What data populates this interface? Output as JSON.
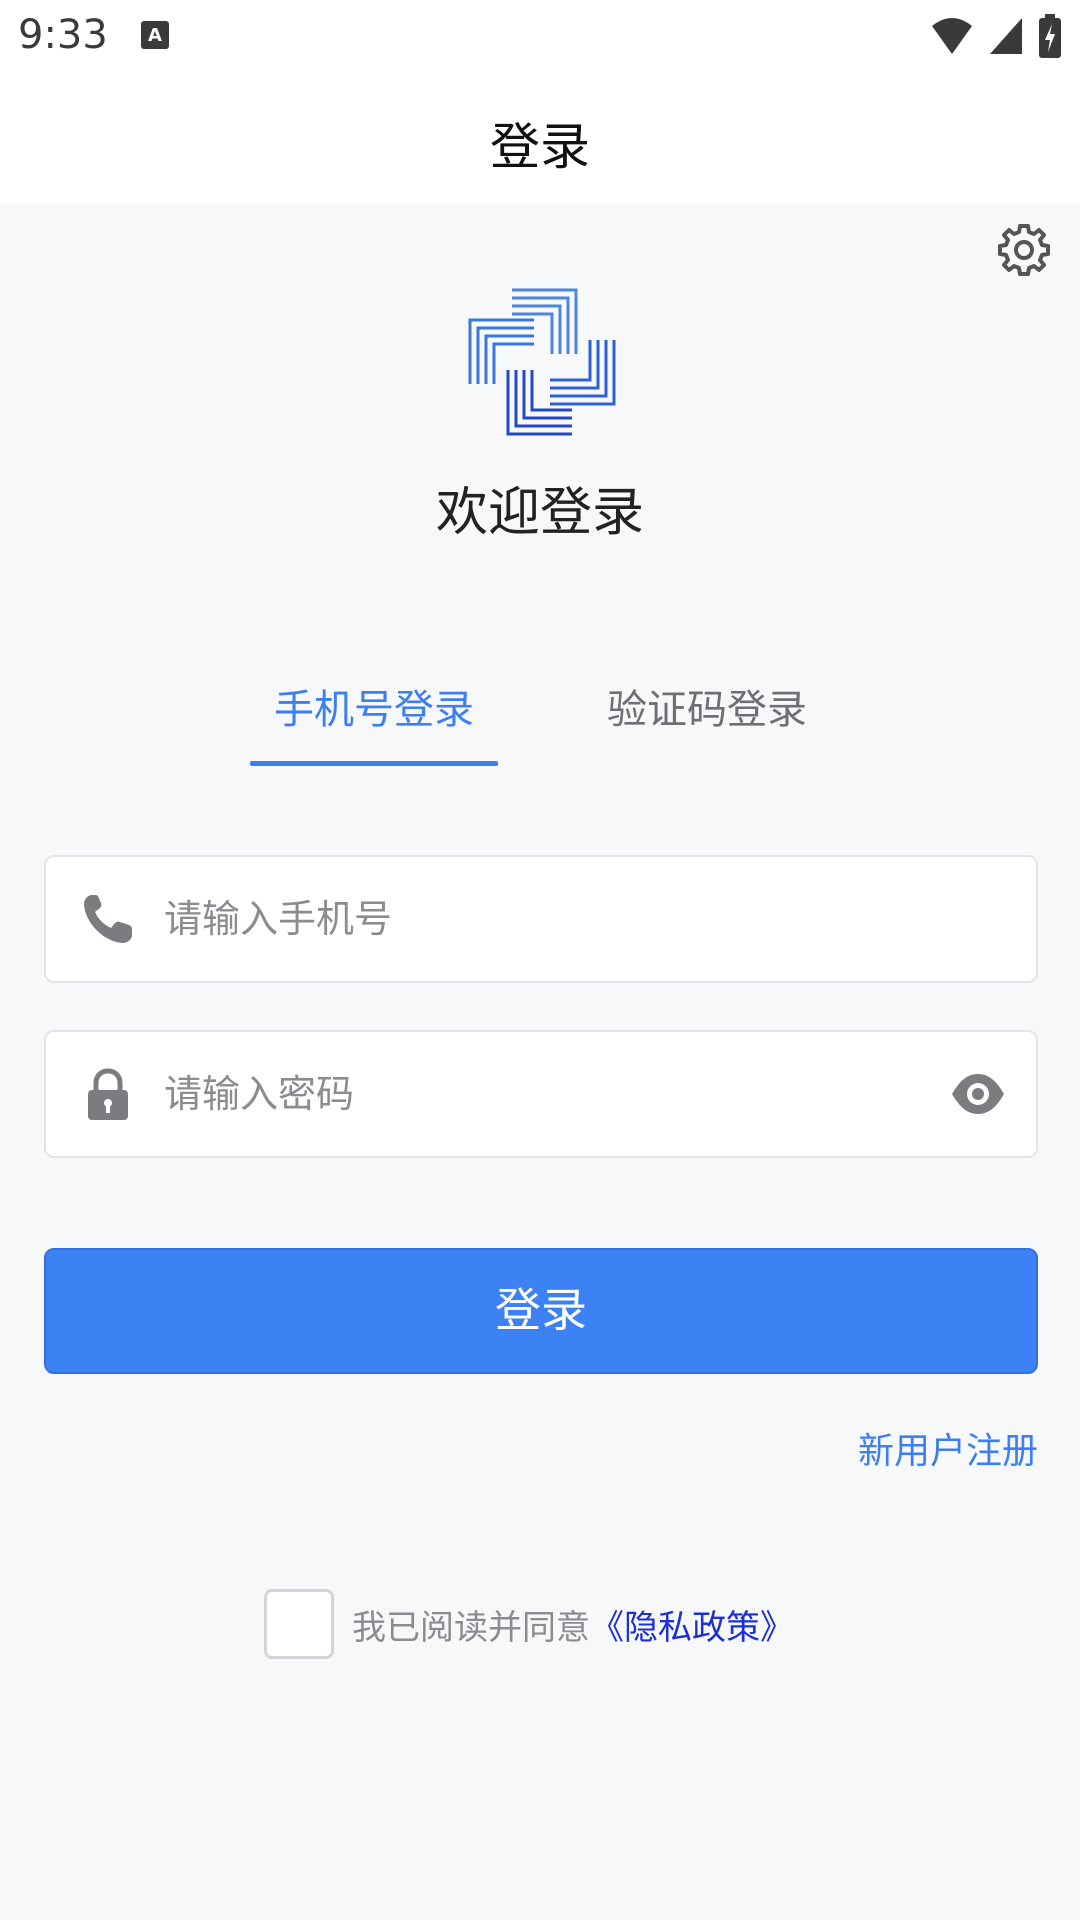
{
  "status_bar": {
    "time": "9:33",
    "notification_icon": "a-keyboard-icon",
    "icons": [
      "wifi-icon",
      "signal-icon",
      "battery-charging-icon"
    ]
  },
  "header": {
    "title": "登录",
    "settings_icon": "gear-icon"
  },
  "brand": {
    "logo_icon": "cross-logo-icon",
    "welcome": "欢迎登录"
  },
  "tabs": [
    {
      "label": "手机号登录",
      "active": true
    },
    {
      "label": "验证码登录",
      "active": false
    }
  ],
  "form": {
    "phone": {
      "placeholder": "请输入手机号",
      "value": "",
      "icon": "phone-icon"
    },
    "password": {
      "placeholder": "请输入密码",
      "value": "",
      "icon": "lock-icon",
      "toggle_icon": "eye-icon"
    },
    "login_label": "登录",
    "register_label": "新用户注册"
  },
  "agreement": {
    "checked": false,
    "text": "我已阅读并同意",
    "link_text": "《隐私政策》"
  },
  "colors": {
    "accent": "#3d7ff0",
    "button": "#3d82f5",
    "link": "#1d2fd6",
    "background": "#f7f8fa"
  }
}
